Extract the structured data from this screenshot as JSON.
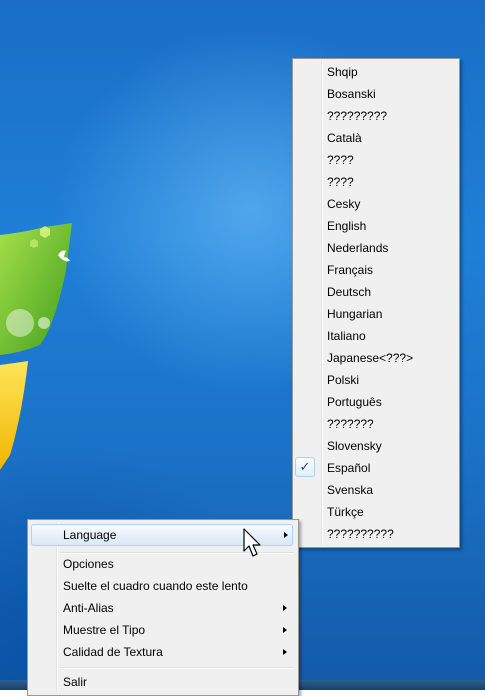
{
  "colors": {
    "desktop_blue": "#1f7fd6",
    "menu_bg": "#f0f0f0",
    "highlight_border": "#aecff7",
    "checkmark": "#1d3f86"
  },
  "language_submenu": {
    "items": [
      {
        "label": "Shqip"
      },
      {
        "label": "Bosanski"
      },
      {
        "label": "?????????"
      },
      {
        "label": "Català"
      },
      {
        "label": "????"
      },
      {
        "label": "????"
      },
      {
        "label": "Cesky"
      },
      {
        "label": "English"
      },
      {
        "label": "Nederlands"
      },
      {
        "label": "Français"
      },
      {
        "label": "Deutsch"
      },
      {
        "label": "Hungarian"
      },
      {
        "label": "Italiano"
      },
      {
        "label": "Japanese<???>"
      },
      {
        "label": "Polski"
      },
      {
        "label": "Português"
      },
      {
        "label": "???????"
      },
      {
        "label": "Slovensky"
      },
      {
        "label": "Español"
      },
      {
        "label": "Svenska"
      },
      {
        "label": "Türkçe"
      },
      {
        "label": "??????????"
      }
    ],
    "checked_label": "Español",
    "check_glyph": "✓"
  },
  "context_menu": {
    "language": "Language",
    "opciones": "Opciones",
    "suelte": "Suelte el cuadro cuando este lento",
    "anti_alias": "Anti-Alias",
    "muestre_tipo": "Muestre el Tipo",
    "calidad_textura": "Calidad de Textura",
    "salir": "Salir"
  },
  "icons": {
    "submenu_arrow": "chevron-right-icon",
    "pointer": "mouse-pointer-icon",
    "logo": "windows-logo-icon"
  }
}
